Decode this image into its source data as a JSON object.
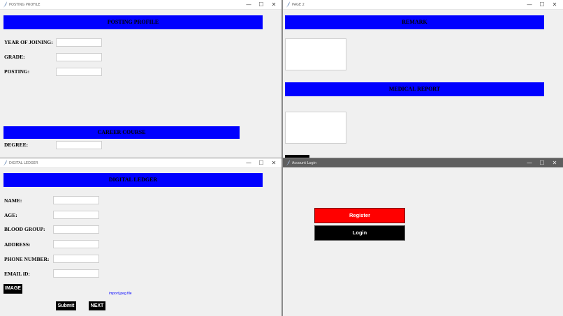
{
  "posting_window": {
    "title": "POSTING PROFILE",
    "banner": "POSTING PROFILE",
    "fields": [
      {
        "label": "YEAR OF JOINING:",
        "value": ""
      },
      {
        "label": "GRADE:",
        "value": ""
      },
      {
        "label": "POSTING:",
        "value": ""
      }
    ],
    "career_banner": "CAREER COURSE",
    "degree_label": "DEGREE:",
    "degree_value": ""
  },
  "page2_window": {
    "title": "PAGE 2",
    "remark_banner": "REMARK",
    "medical_banner": "MEDICAL REPORT"
  },
  "ledger_window": {
    "title": "DIGITAL LEDGER",
    "banner": "DIGITAL LEDGER",
    "fields": [
      {
        "label": "NAME:",
        "value": ""
      },
      {
        "label": "AGE:",
        "value": ""
      },
      {
        "label": "BLOOD GROUP:",
        "value": ""
      },
      {
        "label": "ADDRESS:",
        "value": ""
      },
      {
        "label": "PHONE NUMBER:",
        "value": ""
      },
      {
        "label": "EMAIL iD:",
        "value": ""
      }
    ],
    "image_button": "IMAGE",
    "import_note": "import jpeg file",
    "submit_button": "Submit",
    "next_button": "NEXT"
  },
  "login_window": {
    "title": "Account Login",
    "register_button": "Register",
    "login_button": "Login"
  },
  "window_controls": {
    "minimize": "—",
    "maximize": "☐",
    "close": "✕"
  },
  "colors": {
    "banner": "#0000ff",
    "register": "#ff0000",
    "button": "#000000",
    "link": "#0000ff"
  }
}
